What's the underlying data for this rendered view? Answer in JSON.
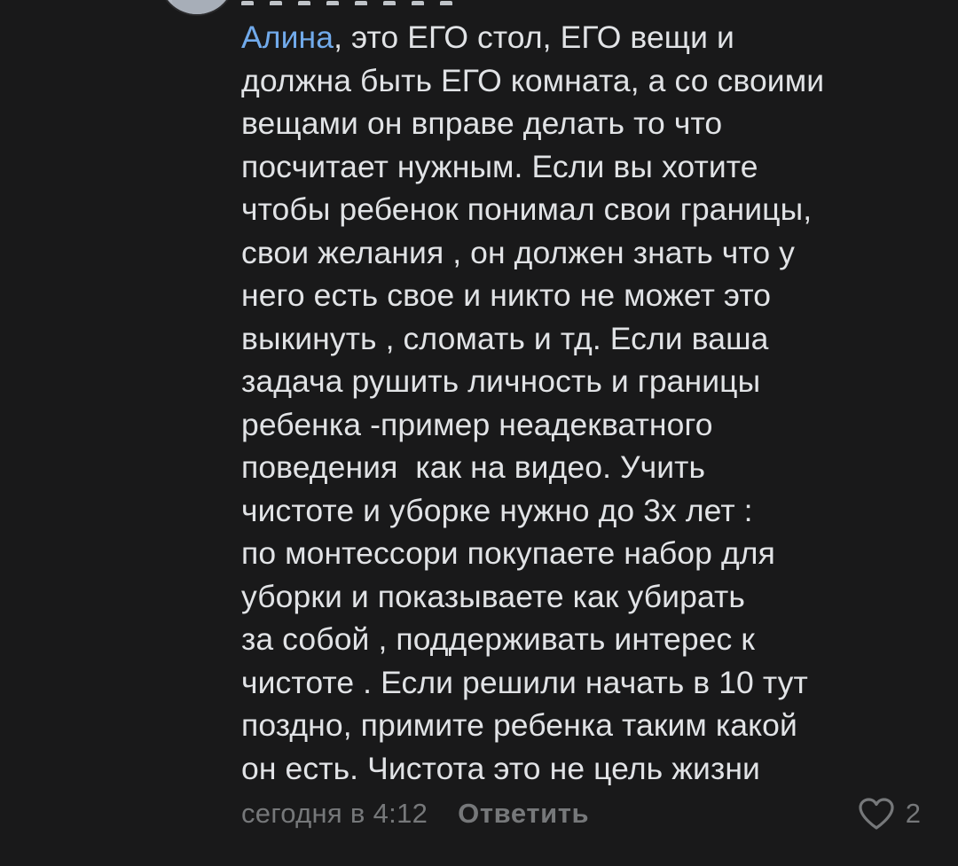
{
  "comment": {
    "mention": "Алина",
    "text": ", это ЕГО стол, ЕГО вещи и\nдолжна быть ЕГО комната, а со своими\nвещами он вправе делать то что\nпосчитает нужным. Если вы хотите\nчтобы ребенок понимал свои границы,\nсвои желания , он должен знать что у\nнего есть свое и никто не может это\nвыкинуть , сломать и тд. Если ваша\nзадача рушить личность и границы\nребенка -пример неадекватного\nповедения  как на видео. Учить\nчистоте и уборке нужно до 3х лет :\nпо монтессори покупаете набор для\nуборки и показываете как убирать\nза собой , поддерживать интерес к\nчистоте . Если решили начать в 10 тут\nпоздно, примите ребенка таким какой\nон есть. Чистота это не цель жизни"
  },
  "footer": {
    "timestamp": "сегодня в 4:12",
    "reply_label": "Ответить",
    "like_count": "2",
    "like_icon": "heart-outline-icon"
  },
  "colors": {
    "background": "#19191a",
    "text": "#e1e3e6",
    "mention": "#71aaeb",
    "secondary": "#76787a"
  }
}
